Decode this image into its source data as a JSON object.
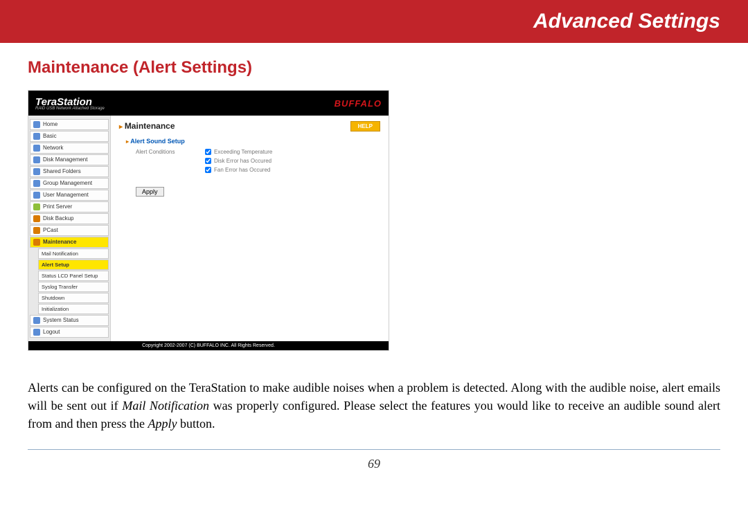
{
  "banner": {
    "title": "Advanced Settings"
  },
  "section": {
    "heading": "Maintenance (Alert Settings)"
  },
  "screenshot": {
    "header": {
      "logo": "TeraStation",
      "logo_sub": "RAID USB Network Attached Storage",
      "brand": "BUFFALO"
    },
    "sidebar": {
      "items": [
        {
          "label": "Home",
          "ico": "#5b8dd6"
        },
        {
          "label": "Basic",
          "ico": "#5b8dd6"
        },
        {
          "label": "Network",
          "ico": "#5b8dd6"
        },
        {
          "label": "Disk Management",
          "ico": "#5b8dd6"
        },
        {
          "label": "Shared Folders",
          "ico": "#5b8dd6"
        },
        {
          "label": "Group Management",
          "ico": "#5b8dd6"
        },
        {
          "label": "User Management",
          "ico": "#5b8dd6"
        },
        {
          "label": "Print Server",
          "ico": "#8fbf3a"
        },
        {
          "label": "Disk Backup",
          "ico": "#d97a00"
        },
        {
          "label": "PCast",
          "ico": "#d97a00"
        },
        {
          "label": "Maintenance",
          "ico": "#d97a00",
          "active": true
        }
      ],
      "sub_items": [
        {
          "label": "Mail Notification"
        },
        {
          "label": "Alert Setup",
          "active": true
        },
        {
          "label": "Status LCD Panel Setup"
        },
        {
          "label": "Syslog Transfer"
        },
        {
          "label": "Shutdown"
        },
        {
          "label": "Initialization"
        }
      ],
      "tail_items": [
        {
          "label": "System Status",
          "ico": "#5b8dd6"
        },
        {
          "label": "Logout",
          "ico": "#5b8dd6"
        }
      ]
    },
    "content": {
      "title": "Maintenance",
      "help": "HELP",
      "sub": "Alert Sound Setup",
      "field_label": "Alert Conditions",
      "checks": [
        "Exceeding Temperature",
        "Disk Error has Occured",
        "Fan Error has Occured"
      ],
      "apply": "Apply"
    },
    "footer": "Copyright 2002-2007 (C) BUFFALO INC. All Rights Reserved."
  },
  "paragraph": {
    "t1": "Alerts can be configured on the TeraStation to make audible noises when a problem is detected. Along with the audible noise, alert emails will be sent out if ",
    "em1": "Mail Notification",
    "t2": " was properly configured. Please select the features you would like to receive an audible sound alert from and then press the ",
    "em2": "Apply",
    "t3": " button."
  },
  "page_number": "69"
}
